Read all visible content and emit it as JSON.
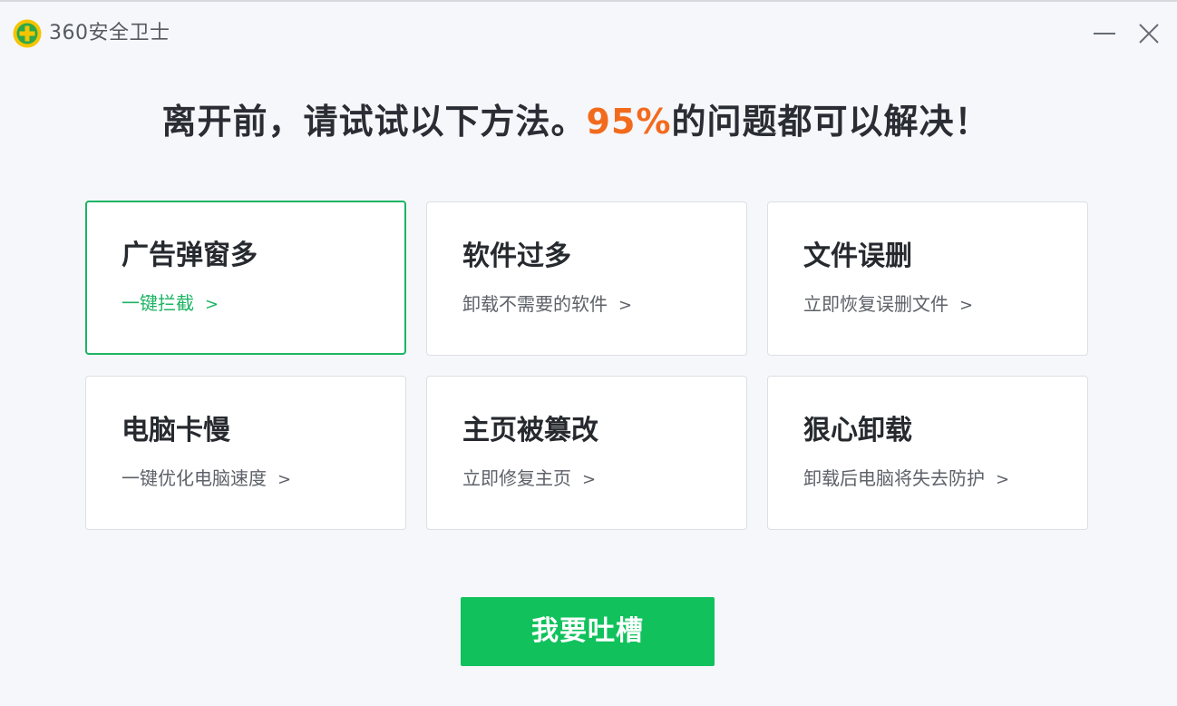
{
  "window": {
    "title": "360安全卫士"
  },
  "headline": {
    "prefix": "离开前，请试试以下方法。",
    "highlight": "95%",
    "suffix": "的问题都可以解决！"
  },
  "cards": [
    {
      "title": "广告弹窗多",
      "action": "一键拦截"
    },
    {
      "title": "软件过多",
      "action": "卸载不需要的软件"
    },
    {
      "title": "文件误删",
      "action": "立即恢复误删文件"
    },
    {
      "title": "电脑卡慢",
      "action": "一键优化电脑速度"
    },
    {
      "title": "主页被篡改",
      "action": "立即修复主页"
    },
    {
      "title": "狠心卸载",
      "action": "卸载后电脑将失去防护"
    }
  ],
  "arrow_glyph": ">",
  "feedback_button": "我要吐槽",
  "colors": {
    "accent_orange": "#f26b1d",
    "brand_green": "#11c25c",
    "active_border": "#1db464",
    "logo_yellow": "#f5c400",
    "logo_green": "#2ca84a"
  }
}
